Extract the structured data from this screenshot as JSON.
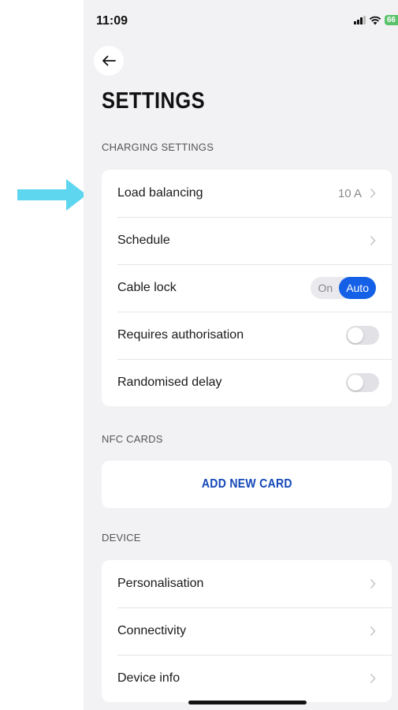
{
  "status_bar": {
    "time": "11:09",
    "battery": "66"
  },
  "header": {
    "title": "SETTINGS"
  },
  "charging_settings": {
    "header": "CHARGING SETTINGS",
    "load_balancing": {
      "label": "Load balancing",
      "value": "10 A"
    },
    "schedule": {
      "label": "Schedule"
    },
    "cable_lock": {
      "label": "Cable lock",
      "options": [
        "On",
        "Auto"
      ],
      "selected": "Auto"
    },
    "requires_authorisation": {
      "label": "Requires authorisation",
      "enabled": false
    },
    "randomised_delay": {
      "label": "Randomised delay",
      "enabled": false
    }
  },
  "nfc_cards": {
    "header": "NFC CARDS",
    "add_button": "ADD NEW CARD"
  },
  "device": {
    "header": "DEVICE",
    "items": [
      {
        "label": "Personalisation"
      },
      {
        "label": "Connectivity"
      },
      {
        "label": "Device info"
      }
    ]
  },
  "colors": {
    "accent_blue": "#1460e6",
    "button_text_blue": "#1448b8",
    "annotation_arrow": "#5ed6f0",
    "background": "#f2f2f4"
  },
  "icons": {
    "back": "arrow-left-icon",
    "chevron": "chevron-right-icon",
    "annotation": "arrow-right-annotation"
  }
}
